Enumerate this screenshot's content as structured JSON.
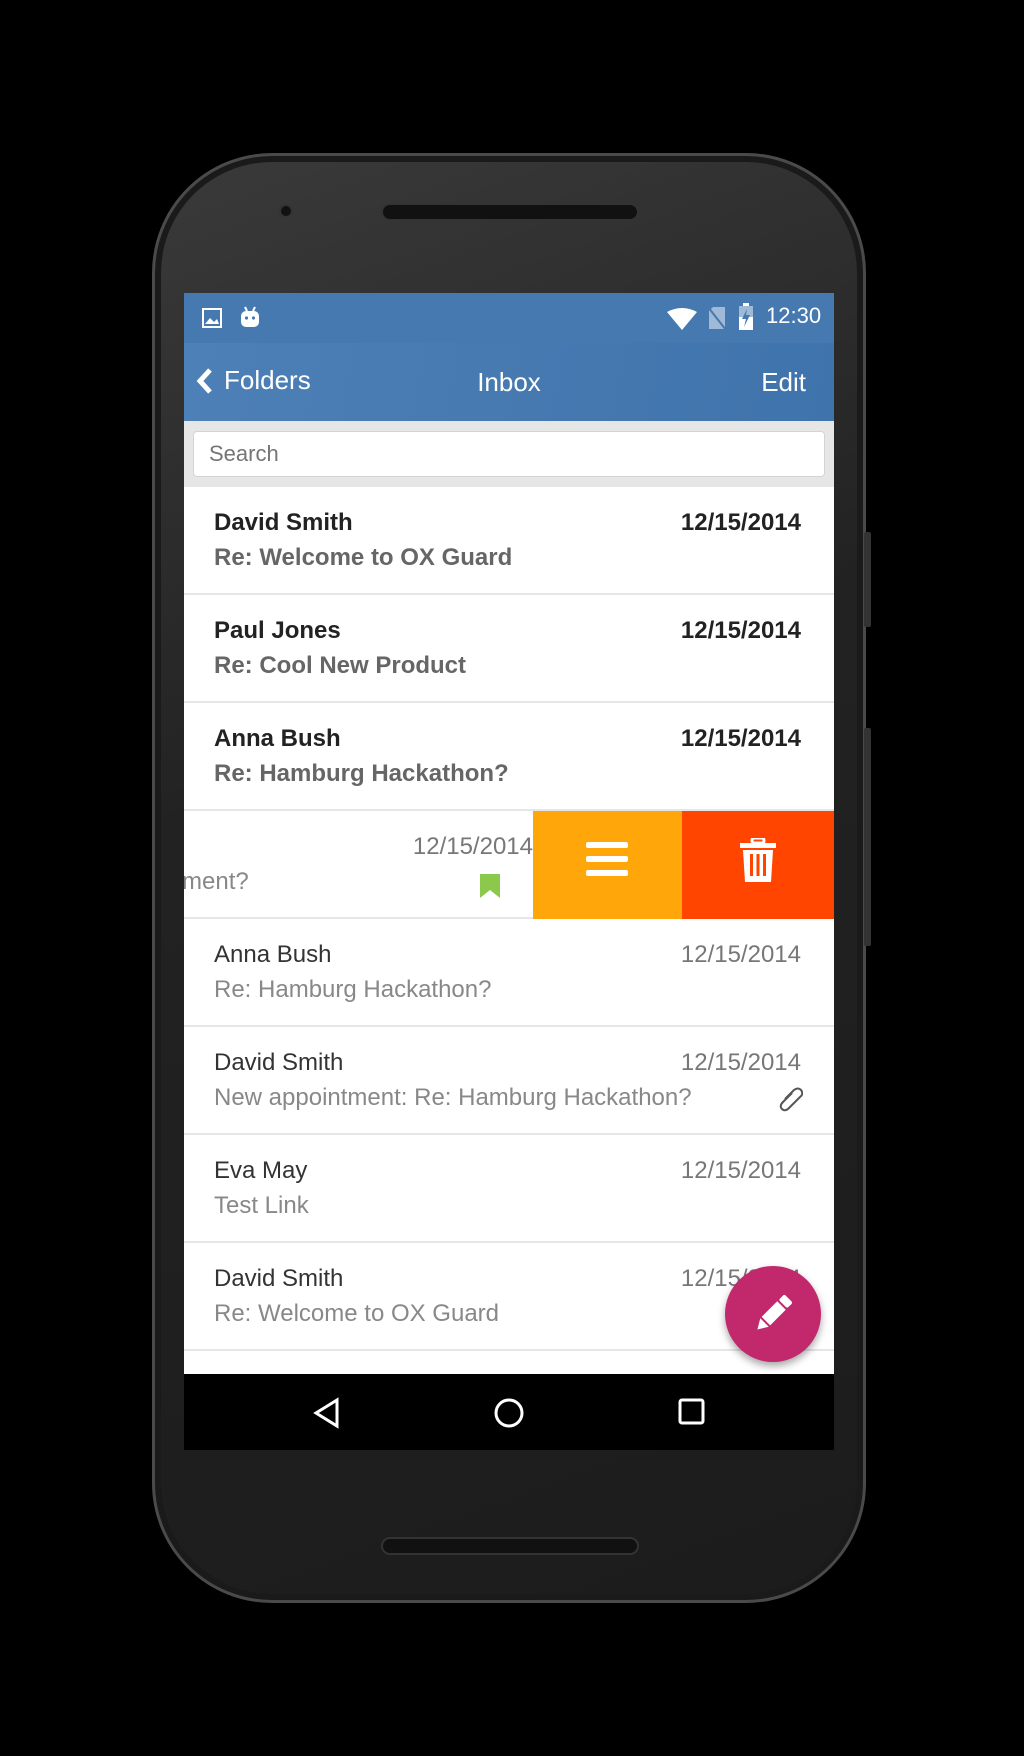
{
  "status": {
    "time": "12:30",
    "icons": [
      "image-icon",
      "android-icon",
      "wifi-icon",
      "no-sim-icon",
      "battery-charging-icon"
    ]
  },
  "appbar": {
    "back_label": "Folders",
    "title": "Inbox",
    "edit_label": "Edit"
  },
  "search": {
    "placeholder": "Search",
    "value": ""
  },
  "messages": [
    {
      "sender": "David Smith",
      "subject": "Re: Welcome to OX Guard",
      "date": "12/15/2014",
      "unread": true
    },
    {
      "sender": "Paul Jones",
      "subject": "Re: Cool New Product",
      "date": "12/15/2014",
      "unread": true
    },
    {
      "sender": "Anna Bush",
      "subject": "Re: Hamburg Hackathon?",
      "date": "12/15/2014",
      "unread": true
    },
    {
      "sender": "",
      "subject": "ment?",
      "date": "12/15/2014",
      "unread": false,
      "flag": "bookmark-icon",
      "swiped": true
    },
    {
      "sender": "Anna Bush",
      "subject": "Re: Hamburg Hackathon?",
      "date": "12/15/2014",
      "unread": false
    },
    {
      "sender": "David Smith",
      "subject": "New appointment: Re: Hamburg Hackathon?",
      "date": "12/15/2014",
      "unread": false,
      "attachment": true
    },
    {
      "sender": "Eva May",
      "subject": "Test Link",
      "date": "12/15/2014",
      "unread": false
    },
    {
      "sender": "David Smith",
      "subject": "Re: Welcome to OX Guard",
      "date": "12/15/2014",
      "unread": false
    }
  ],
  "swipe_actions": [
    {
      "name": "more",
      "icon": "menu-icon",
      "color": "#ffa60a"
    },
    {
      "name": "delete",
      "icon": "trash-icon",
      "color": "#ff4500"
    }
  ],
  "colors": {
    "appbar": "#4579b0",
    "fab": "#c2286c",
    "flag": "#8cc84b"
  }
}
